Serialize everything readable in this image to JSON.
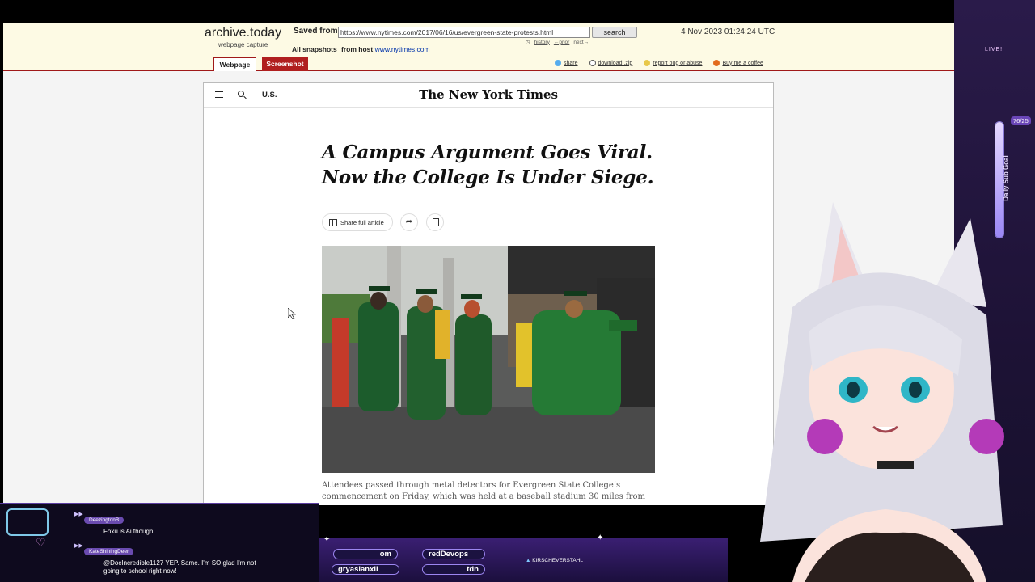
{
  "archive": {
    "site_title": "archive.today",
    "site_subtitle": "webpage capture",
    "saved_from_label": "Saved from",
    "url_value": "https://www.nytimes.com/2017/06/16/us/evergreen-state-protests.html",
    "search_label": "search",
    "history_label": "history",
    "prior_label": "←prior",
    "next_label": "next→",
    "capture_date": "4 Nov 2023 01:24:24 UTC",
    "all_snapshots_label": "All snapshots",
    "from_host_label": "from host",
    "host_link": "www.nytimes.com",
    "tabs": [
      {
        "label": "Webpage"
      },
      {
        "label": "Screenshot"
      }
    ],
    "tools": [
      {
        "label": "share",
        "icon": "twitter-icon"
      },
      {
        "label": "download .zip",
        "icon": "cloud-icon"
      },
      {
        "label": "report bug or abuse",
        "icon": "bug-icon"
      },
      {
        "label": "Buy me a coffee",
        "icon": "coffee-icon"
      }
    ]
  },
  "nyt": {
    "section": "U.S.",
    "masthead": "The New York Times",
    "headline": "A Campus Argument Goes Viral. Now the College Is Under Siege.",
    "share_full_article": "Share full article",
    "caption": "Attendees passed through metal detectors for Evergreen State College’s commencement on Friday, which was held at a baseball stadium 30 miles from"
  },
  "stream": {
    "live_label": "LIVE!",
    "goal_label": "Daily Sub Goal",
    "goal_count": "76/25",
    "goal_fraction": 1.0,
    "chat": [
      {
        "user": "DeezingtonB",
        "text": "Foxu is Ai though"
      },
      {
        "user": "KateShiningDeer",
        "text": "@DocIncredible1127 YEP. Same. I'm SO glad I'm not going to school right now!"
      }
    ],
    "pills": [
      {
        "label": "om"
      },
      {
        "label": "redDevops"
      },
      {
        "label": "gryasianxii"
      },
      {
        "label": "tdn"
      }
    ],
    "ticker": "KIRSCHEVERSTAHL"
  },
  "colors": {
    "archive_red": "#b01f1f",
    "archive_bg": "#fdfae4",
    "stream_purple": "#2a1b4a"
  }
}
